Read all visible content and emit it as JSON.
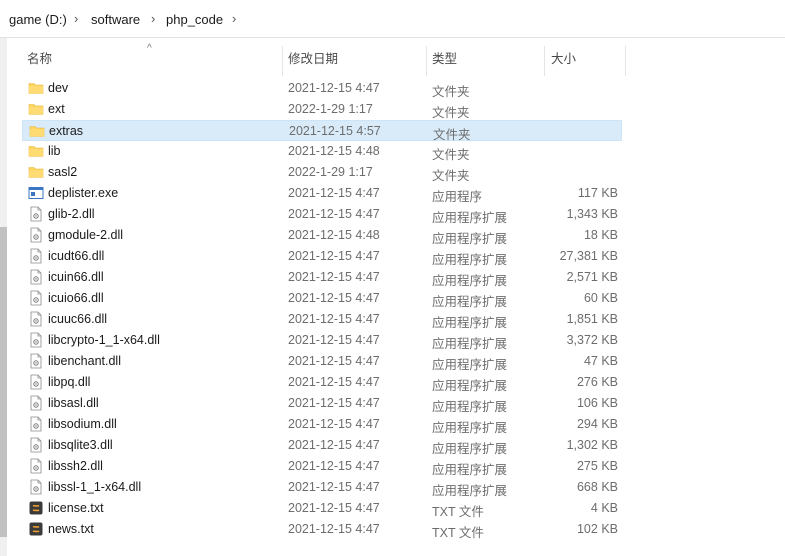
{
  "breadcrumb": [
    {
      "label": "game (D:)"
    },
    {
      "label": "software"
    },
    {
      "label": "php_code"
    }
  ],
  "columns": {
    "name": "名称",
    "date": "修改日期",
    "type": "类型",
    "size": "大小"
  },
  "files": [
    {
      "name": "dev",
      "date": "2021-12-15 4:47",
      "type": "文件夹",
      "size": "",
      "icon": "folder-icon"
    },
    {
      "name": "ext",
      "date": "2022-1-29 1:17",
      "type": "文件夹",
      "size": "",
      "icon": "folder-icon"
    },
    {
      "name": "extras",
      "date": "2021-12-15 4:57",
      "type": "文件夹",
      "size": "",
      "icon": "folder-icon",
      "selected": true
    },
    {
      "name": "lib",
      "date": "2021-12-15 4:48",
      "type": "文件夹",
      "size": "",
      "icon": "folder-icon"
    },
    {
      "name": "sasl2",
      "date": "2022-1-29 1:17",
      "type": "文件夹",
      "size": "",
      "icon": "folder-icon"
    },
    {
      "name": "deplister.exe",
      "date": "2021-12-15 4:47",
      "type": "应用程序",
      "size": "117 KB",
      "icon": "exe-icon"
    },
    {
      "name": "glib-2.dll",
      "date": "2021-12-15 4:47",
      "type": "应用程序扩展",
      "size": "1,343 KB",
      "icon": "dll-icon"
    },
    {
      "name": "gmodule-2.dll",
      "date": "2021-12-15 4:48",
      "type": "应用程序扩展",
      "size": "18 KB",
      "icon": "dll-icon"
    },
    {
      "name": "icudt66.dll",
      "date": "2021-12-15 4:47",
      "type": "应用程序扩展",
      "size": "27,381 KB",
      "icon": "dll-icon"
    },
    {
      "name": "icuin66.dll",
      "date": "2021-12-15 4:47",
      "type": "应用程序扩展",
      "size": "2,571 KB",
      "icon": "dll-icon"
    },
    {
      "name": "icuio66.dll",
      "date": "2021-12-15 4:47",
      "type": "应用程序扩展",
      "size": "60 KB",
      "icon": "dll-icon"
    },
    {
      "name": "icuuc66.dll",
      "date": "2021-12-15 4:47",
      "type": "应用程序扩展",
      "size": "1,851 KB",
      "icon": "dll-icon"
    },
    {
      "name": "libcrypto-1_1-x64.dll",
      "date": "2021-12-15 4:47",
      "type": "应用程序扩展",
      "size": "3,372 KB",
      "icon": "dll-icon"
    },
    {
      "name": "libenchant.dll",
      "date": "2021-12-15 4:47",
      "type": "应用程序扩展",
      "size": "47 KB",
      "icon": "dll-icon"
    },
    {
      "name": "libpq.dll",
      "date": "2021-12-15 4:47",
      "type": "应用程序扩展",
      "size": "276 KB",
      "icon": "dll-icon"
    },
    {
      "name": "libsasl.dll",
      "date": "2021-12-15 4:47",
      "type": "应用程序扩展",
      "size": "106 KB",
      "icon": "dll-icon"
    },
    {
      "name": "libsodium.dll",
      "date": "2021-12-15 4:47",
      "type": "应用程序扩展",
      "size": "294 KB",
      "icon": "dll-icon"
    },
    {
      "name": "libsqlite3.dll",
      "date": "2021-12-15 4:47",
      "type": "应用程序扩展",
      "size": "1,302 KB",
      "icon": "dll-icon"
    },
    {
      "name": "libssh2.dll",
      "date": "2021-12-15 4:47",
      "type": "应用程序扩展",
      "size": "275 KB",
      "icon": "dll-icon"
    },
    {
      "name": "libssl-1_1-x64.dll",
      "date": "2021-12-15 4:47",
      "type": "应用程序扩展",
      "size": "668 KB",
      "icon": "dll-icon"
    },
    {
      "name": "license.txt",
      "date": "2021-12-15 4:47",
      "type": "TXT 文件",
      "size": "4 KB",
      "icon": "txt-icon"
    },
    {
      "name": "news.txt",
      "date": "2021-12-15 4:47",
      "type": "TXT 文件",
      "size": "102 KB",
      "icon": "txt-icon"
    }
  ],
  "colors": {
    "folder": "#ffd45c",
    "selection": "#d9ebf9",
    "txt_icon": "#e8a33a"
  }
}
